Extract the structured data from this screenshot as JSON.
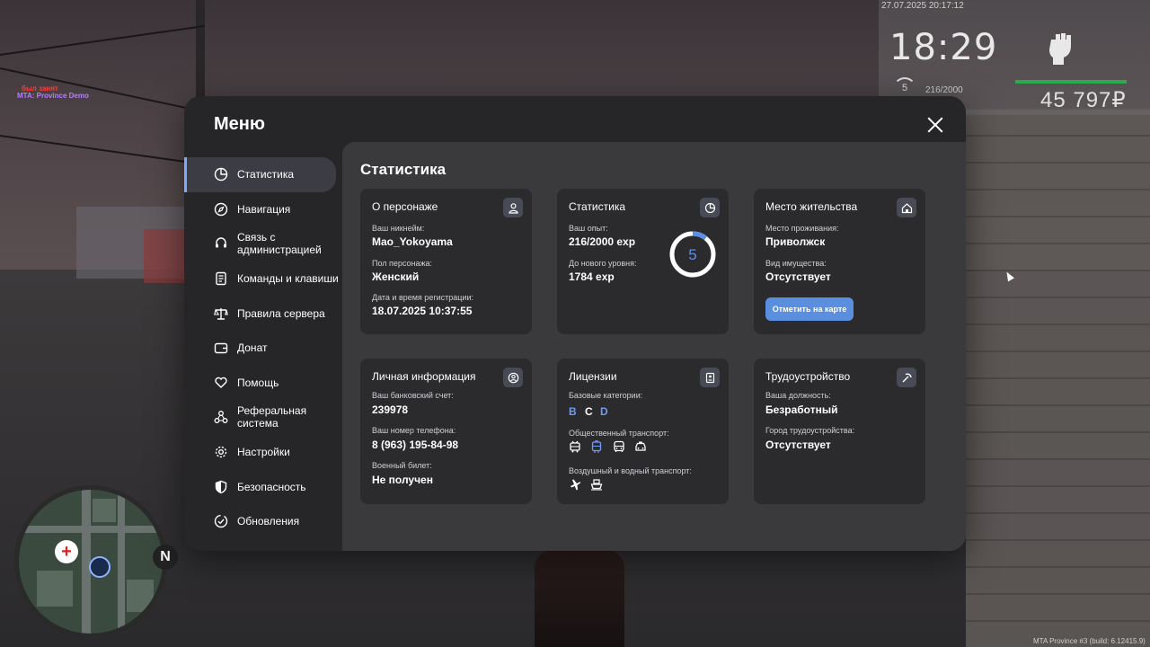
{
  "hud": {
    "server_line1": "был занят",
    "server_line2": "MTA: Province Demo",
    "datetime": "27.07.2025 20:17:12",
    "clock": "18:29",
    "level": "5",
    "exp": "216/2000",
    "money": "45 797₽",
    "build": "MTA Province #3 (build: 6.12415.9)",
    "north": "N"
  },
  "menu": {
    "title": "Меню",
    "sidebar": [
      {
        "label": "Статистика",
        "icon": "pie-chart-icon",
        "active": true
      },
      {
        "label": "Навигация",
        "icon": "compass-icon"
      },
      {
        "label": "Связь с администрацией",
        "icon": "headset-icon"
      },
      {
        "label": "Команды и клавиши",
        "icon": "document-icon"
      },
      {
        "label": "Правила сервера",
        "icon": "scales-icon"
      },
      {
        "label": "Донат",
        "icon": "wallet-icon"
      },
      {
        "label": "Помощь",
        "icon": "heart-hands-icon"
      },
      {
        "label": "Реферальная система",
        "icon": "network-icon"
      },
      {
        "label": "Настройки",
        "icon": "gear-icon"
      },
      {
        "label": "Безопасность",
        "icon": "shield-icon"
      },
      {
        "label": "Обновления",
        "icon": "check-circle-icon"
      }
    ]
  },
  "content": {
    "title": "Статистика",
    "character": {
      "title": "О персонаже",
      "nickname_label": "Ваш никнейм:",
      "nickname": "Mao_Yokoyama",
      "gender_label": "Пол персонажа:",
      "gender": "Женский",
      "reg_label": "Дата и время регистрации:",
      "reg": "18.07.2025 10:37:55"
    },
    "stats": {
      "title": "Статистика",
      "exp_label": "Ваш опыт:",
      "exp": "216/2000 exp",
      "next_label": "До нового уровня:",
      "next": "1784 exp",
      "level": "5",
      "progress": 0.108
    },
    "residence": {
      "title": "Место жительства",
      "place_label": "Место проживания:",
      "place": "Приволжск",
      "property_label": "Вид имущества:",
      "property": "Отсутствует",
      "button": "Отметить на карте"
    },
    "personal": {
      "title": "Личная информация",
      "bank_label": "Ваш банковский счет:",
      "bank": "239978",
      "phone_label": "Ваш номер телефона:",
      "phone": "8 (963) 195-84-98",
      "military_label": "Военный билет:",
      "military": "Не получен"
    },
    "licenses": {
      "title": "Лицензии",
      "base_label": "Базовые категории:",
      "categories": [
        {
          "letter": "B",
          "color": "#6f9cf0"
        },
        {
          "letter": "C",
          "color": "#ffffff"
        },
        {
          "letter": "D",
          "color": "#6f9cf0"
        }
      ],
      "public_label": "Общественный транспорт:",
      "air_label": "Воздушный и водный транспорт:"
    },
    "employment": {
      "title": "Трудоустройство",
      "position_label": "Ваша должность:",
      "position": "Безработный",
      "city_label": "Город трудоустройства:",
      "city": "Отсутствует"
    }
  }
}
